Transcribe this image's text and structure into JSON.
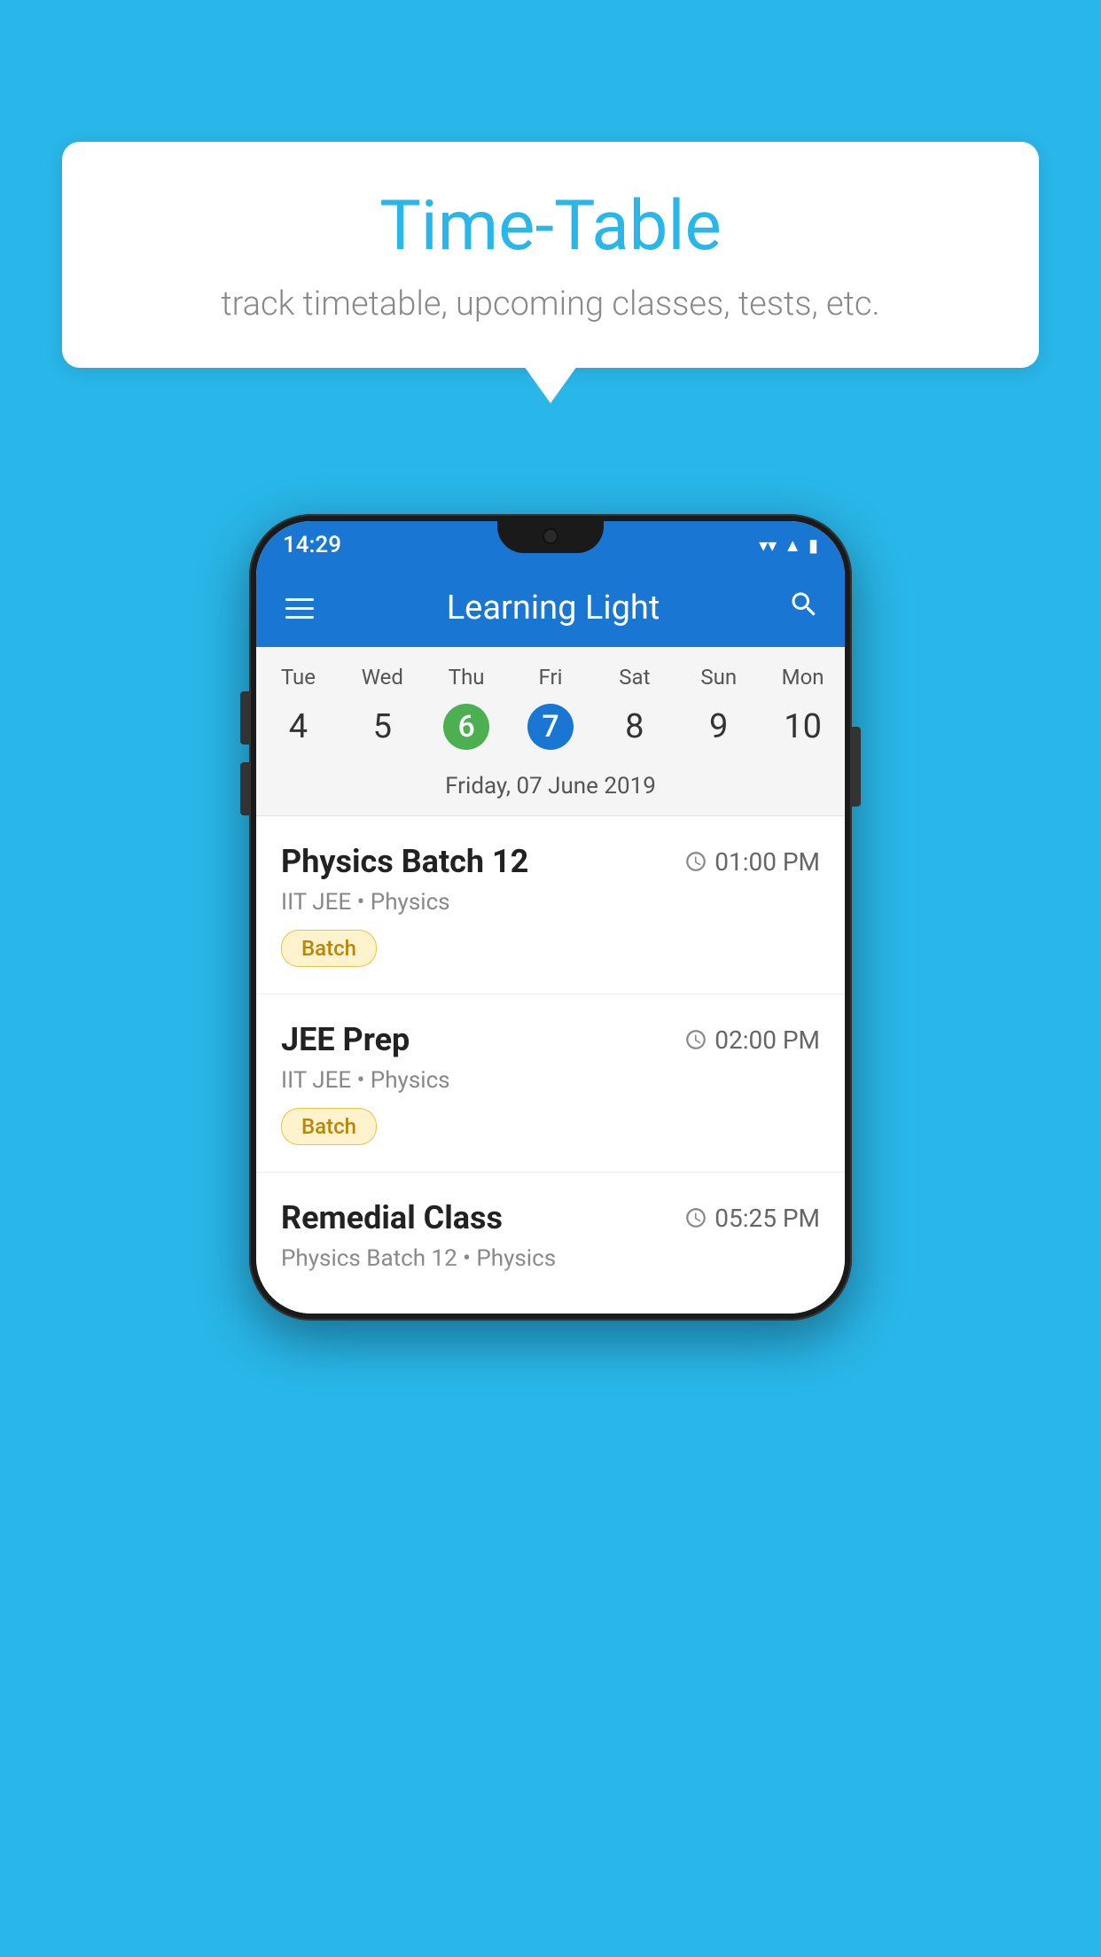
{
  "background_color": "#29B6E8",
  "bubble": {
    "title": "Time-Table",
    "subtitle": "track timetable, upcoming classes, tests, etc."
  },
  "status_bar": {
    "time": "14:29",
    "wifi_icon": "▼",
    "signal_icon": "▲",
    "battery_icon": "▮"
  },
  "app_bar": {
    "title": "Learning Light",
    "menu_icon": "hamburger",
    "search_icon": "search"
  },
  "calendar": {
    "days": [
      {
        "label": "Tue",
        "number": "4"
      },
      {
        "label": "Wed",
        "number": "5"
      },
      {
        "label": "Thu",
        "number": "6",
        "state": "today"
      },
      {
        "label": "Fri",
        "number": "7",
        "state": "selected"
      },
      {
        "label": "Sat",
        "number": "8"
      },
      {
        "label": "Sun",
        "number": "9"
      },
      {
        "label": "Mon",
        "number": "10"
      }
    ],
    "selected_date_label": "Friday, 07 June 2019"
  },
  "schedule": [
    {
      "title": "Physics Batch 12",
      "time": "01:00 PM",
      "subtitle": "IIT JEE • Physics",
      "tag": "Batch"
    },
    {
      "title": "JEE Prep",
      "time": "02:00 PM",
      "subtitle": "IIT JEE • Physics",
      "tag": "Batch"
    },
    {
      "title": "Remedial Class",
      "time": "05:25 PM",
      "subtitle": "Physics Batch 12 • Physics",
      "tag": ""
    }
  ]
}
